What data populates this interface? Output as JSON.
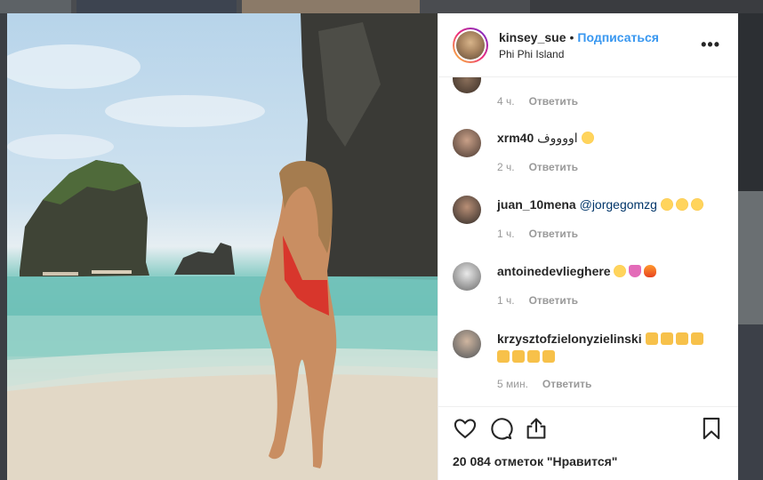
{
  "post": {
    "username": "kinsey_sue",
    "separator": "•",
    "follow_label": "Подписаться",
    "location": "Phi Phi Island",
    "more_label": "•••"
  },
  "comments": [
    {
      "username": "",
      "text": "",
      "time": "4 ч.",
      "reply": "Ответить"
    },
    {
      "username": "xrm40",
      "text": "اووووف",
      "emojis": [
        "heart-eyes"
      ],
      "time": "2 ч.",
      "reply": "Ответить"
    },
    {
      "username": "juan_10mena",
      "mention": "@jorgegomzg",
      "emojis": [
        "rofl",
        "rofl",
        "rofl"
      ],
      "time": "1 ч.",
      "reply": "Ответить"
    },
    {
      "username": "antoinedevlieghere",
      "emojis": [
        "heart-eyes",
        "pink-heart",
        "fire"
      ],
      "time": "1 ч.",
      "reply": "Ответить"
    },
    {
      "username": "krzyszt ofzielonyzielinski",
      "display_username": "krzysztofzielonyzielinski",
      "emojis": [
        "raising-hands",
        "raising-hands",
        "raising-hands",
        "raising-hands",
        "raising-hands",
        "raising-hands",
        "raising-hands",
        "raising-hands"
      ],
      "time": "5 мин.",
      "reply": "Ответить"
    }
  ],
  "footer": {
    "likes": "20 084 отметок \"Нравится\"",
    "icons": [
      "heart-icon",
      "comment-icon",
      "share-icon",
      "bookmark-icon"
    ]
  },
  "colors": {
    "link": "#3897f0",
    "mention": "#003569",
    "meta": "#999999"
  }
}
